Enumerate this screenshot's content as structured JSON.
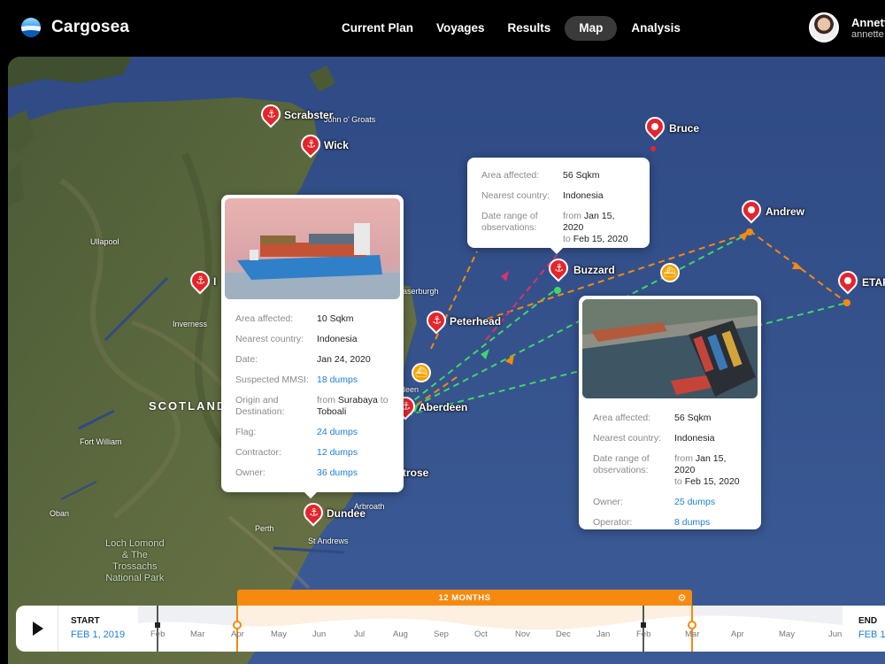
{
  "app": {
    "name": "Cargosea"
  },
  "nav": {
    "items": [
      {
        "label": "Current Plan",
        "active": false
      },
      {
        "label": "Voyages",
        "active": false
      },
      {
        "label": "Results",
        "active": false
      },
      {
        "label": "Map",
        "active": true
      },
      {
        "label": "Analysis",
        "active": false
      }
    ]
  },
  "user": {
    "name": "Annett",
    "email": "annette"
  },
  "map": {
    "places": {
      "scotland": "SCOTLAND",
      "ullapool": "Ullapool",
      "inverness": "Inverness",
      "fort_william": "Fort William",
      "oban": "Oban",
      "perth": "Perth",
      "st_andrews": "St Andrews",
      "arbroath": "Arbroath",
      "john_o_groats": "John o' Groats",
      "fraserburgh": "aserburgh",
      "loch_lomond": "Loch Lomond\n& The\nTrossachs\nNational Park",
      "aberdeen_small": "deen",
      "montrose": "trose",
      "dundee_small": "D"
    },
    "ports": {
      "scrabster": "Scrabster",
      "wick": "Wick",
      "inverness_port": "I",
      "peterhead": "Peterhead",
      "aberdeen": "Aberdeen",
      "dundee": "Dundee"
    },
    "locations": {
      "bruce": "Bruce",
      "andrew": "Andrew",
      "etap": "ETAP",
      "buzzard": "Buzzard"
    }
  },
  "popup_top": {
    "rows": [
      {
        "k": "Area affected:",
        "v": "56 Sqkm"
      },
      {
        "k": "Nearest country:",
        "v": "Indonesia"
      }
    ],
    "date_label": "Date range of observations:",
    "date_from_word": "from",
    "date_from": "Jan 15, 2020",
    "date_to_word": "to",
    "date_to": "Feb 15, 2020"
  },
  "popup_left": {
    "area_k": "Area affected:",
    "area_v": "10 Sqkm",
    "country_k": "Nearest country:",
    "country_v": "Indonesia",
    "date_k": "Date:",
    "date_v": "Jan 24, 2020",
    "mmsi_k": "Suspected MMSI:",
    "mmsi_v": "18 dumps",
    "origin_k": "Origin and Destination:",
    "origin_from_word": "from",
    "origin_from": "Surabaya",
    "origin_to_word": "to",
    "origin_to": "Toboali",
    "flag_k": "Flag:",
    "flag_v": "24 dumps",
    "contractor_k": "Contractor:",
    "contractor_v": "12 dumps",
    "owner_k": "Owner:",
    "owner_v": "36 dumps"
  },
  "popup_right": {
    "area_k": "Area affected:",
    "area_v": "56 Sqkm",
    "country_k": "Nearest country:",
    "country_v": "Indonesia",
    "date_k": "Date range of observations:",
    "date_from_word": "from",
    "date_from": "Jan 15, 2020",
    "date_to_word": "to",
    "date_to": "Feb 15, 2020",
    "owner_k": "Owner:",
    "owner_v": "25 dumps",
    "operator_k": "Operator:",
    "operator_v": "8 dumps"
  },
  "timeline": {
    "start_label": "START",
    "start_date": "FEB 1, 2019",
    "end_label": "END",
    "end_date": "FEB 1,",
    "selection_label": "12 MONTHS",
    "months": [
      "Feb",
      "Mar",
      "Apr",
      "May",
      "Jun",
      "Jul",
      "Aug",
      "Sep",
      "Oct",
      "Nov",
      "Dec",
      "Jan",
      "Feb",
      "Mar",
      "Apr",
      "May",
      "Jun"
    ]
  },
  "colors": {
    "accent": "#f6890f",
    "pin": "#e3262c",
    "link": "#1e7fd6",
    "route_green": "#3fd66a",
    "route_orange": "#f6890f",
    "route_red": "#e0306a"
  }
}
